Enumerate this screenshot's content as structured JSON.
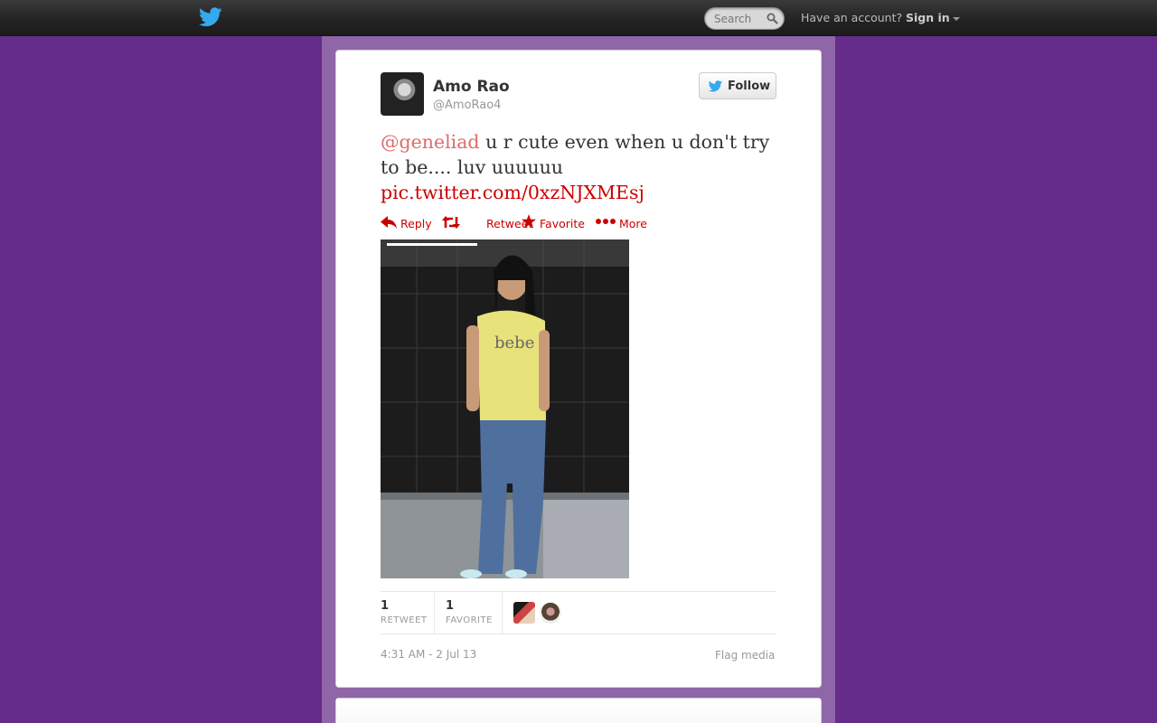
{
  "topbar": {
    "search_placeholder": "Search",
    "have_account": "Have an account?",
    "sign_in": "Sign in"
  },
  "tweet": {
    "author": {
      "name": "Amo Rao",
      "handle": "@AmoRao4"
    },
    "follow_label": "Follow",
    "mention": "@geneliad",
    "text": " u r cute even when u don't try to be.... luv uuuuuu ",
    "link": "pic.twitter.com/0xzNJXMEsj",
    "actions": {
      "reply": "Reply",
      "retweet": "Retweet",
      "favorite": "Favorite",
      "more": "More"
    },
    "stats": {
      "retweet_count": "1",
      "retweet_label": "RETWEET",
      "favorite_count": "1",
      "favorite_label": "FAVORITE"
    },
    "timestamp": "4:31 AM - 2 Jul 13",
    "flag_label": "Flag media"
  },
  "colors": {
    "background": "#652d89",
    "column": "#8f66a7",
    "link": "#cc0000",
    "twitter_blue": "#33aaed"
  },
  "icons": [
    "twitter-bird-icon",
    "search-icon",
    "reply-icon",
    "retweet-icon",
    "star-icon",
    "more-dots-icon"
  ]
}
